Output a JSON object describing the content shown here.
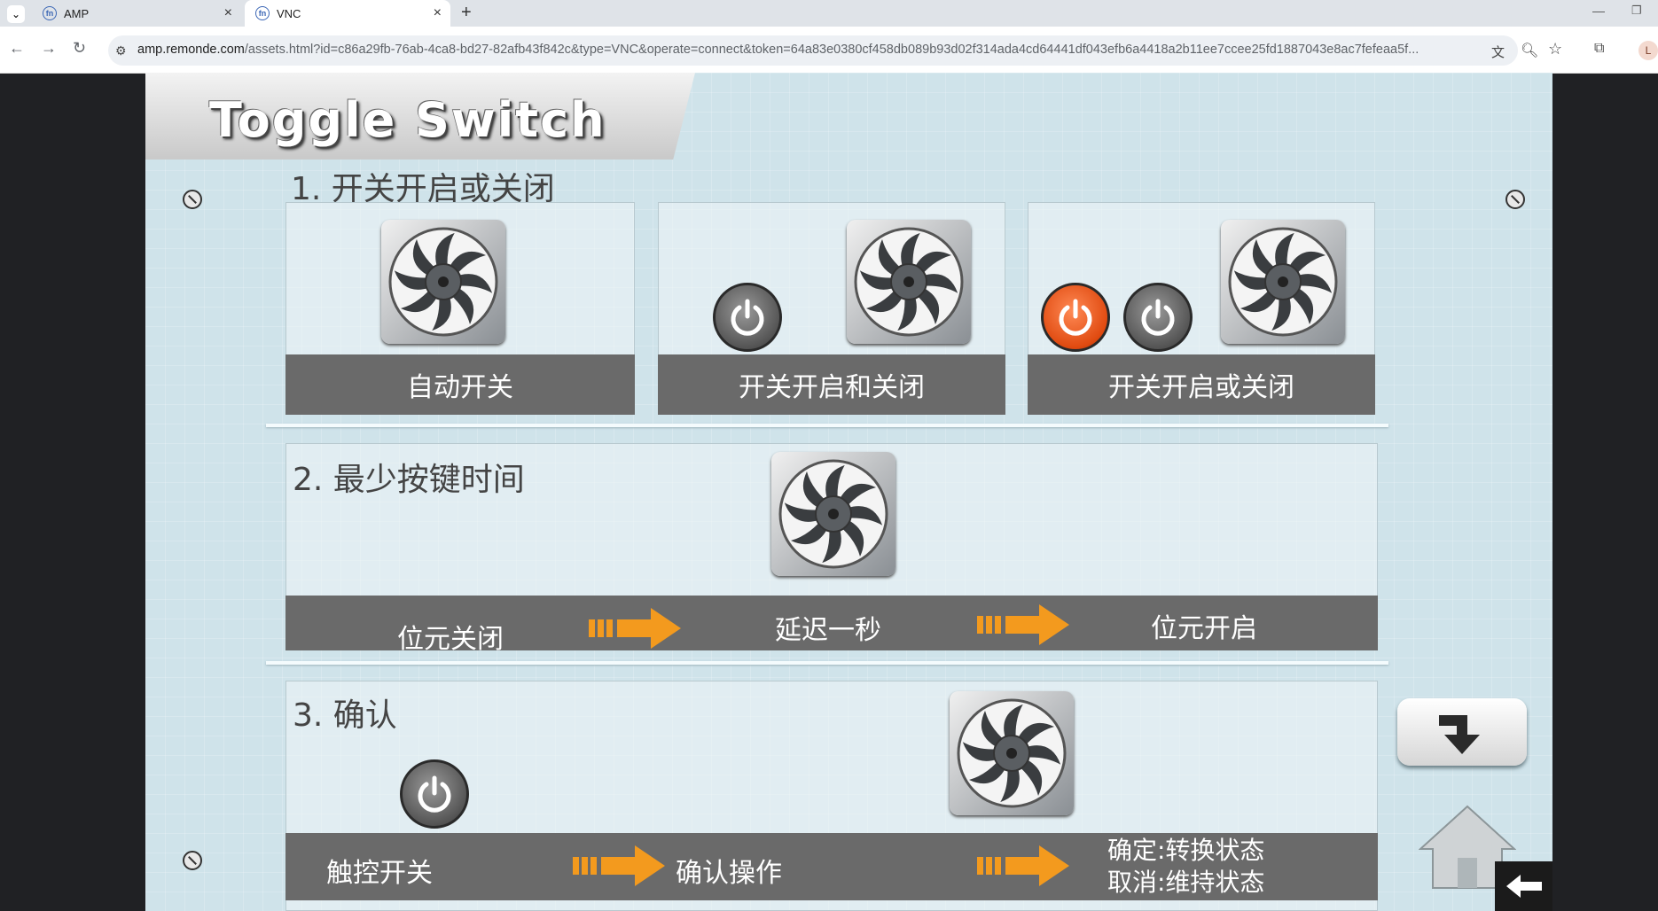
{
  "browser": {
    "tabs": [
      {
        "label": "AMP",
        "icon": "fn-favicon",
        "active": false
      },
      {
        "label": "VNC",
        "icon": "fn-favicon",
        "active": true
      }
    ],
    "url_domain": "amp.remonde.com",
    "url_path": "/assets.html?id=c86a29fb-76ab-4ca8-bd27-82afb43f842c&type=VNC&operate=connect&token=64a83e0380cf458db089b93d02f314ada4cd64441df043efb6a4418a2b11ee7ccee25fd1887043e8ac7fefeaa5f...",
    "profile_initial": "L"
  },
  "screen": {
    "title": "Toggle Switch",
    "section1": {
      "heading": "1. 开关开启或关闭",
      "cards": [
        "自动开关",
        "开关开启和关闭",
        "开关开启或关闭"
      ]
    },
    "section2": {
      "heading": "2. 最少按键时间",
      "steps": [
        "位元关闭",
        "延迟一秒",
        "位元开启"
      ]
    },
    "section3": {
      "heading": "3. 确认",
      "steps": [
        "触控开关",
        "确认操作"
      ],
      "result_line1": "确定:转换状态",
      "result_line2": "取消:维持状态"
    },
    "colors": {
      "accent_orange": "#f39a1e",
      "bar_gray": "#6a6a6a",
      "power_on": "#e04a10"
    }
  }
}
